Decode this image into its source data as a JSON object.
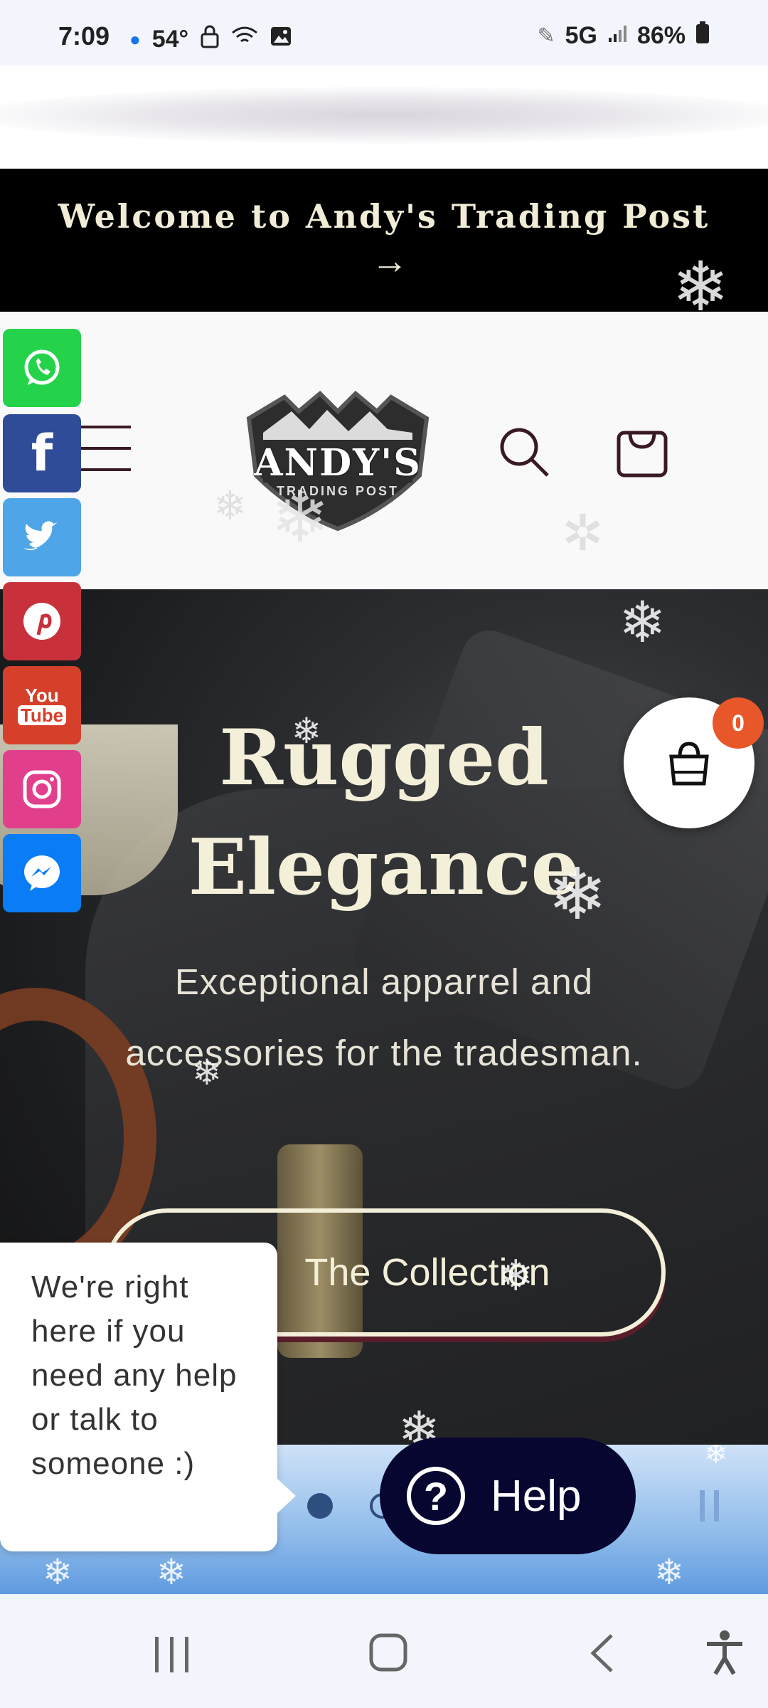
{
  "status_bar": {
    "time": "7:09",
    "temp": "54°",
    "network": "5G",
    "battery": "86%"
  },
  "announcement": {
    "text": "Welcome to Andy's Trading Post",
    "arrow": "→"
  },
  "header": {
    "logo_line1": "ANDY'S",
    "logo_line2": "TRADING POST"
  },
  "hero": {
    "title_line1": "Rugged",
    "title_line2": "Elegance",
    "subtitle": "Exceptional apparrel and accessories for the tradesman.",
    "cta_label": "The Collection"
  },
  "floating_cart": {
    "count": "0"
  },
  "help": {
    "bubble_text": "We're right here if you need any help or talk to someone :)",
    "button_label": "Help",
    "button_icon": "?"
  },
  "social": {
    "facebook": "f",
    "youtube_line1": "You",
    "youtube_line2": "Tube"
  },
  "colors": {
    "announcement_bg": "#000000",
    "hero_text": "#f4efd9",
    "help_button": "#060630",
    "cart_badge": "#e8572a"
  }
}
